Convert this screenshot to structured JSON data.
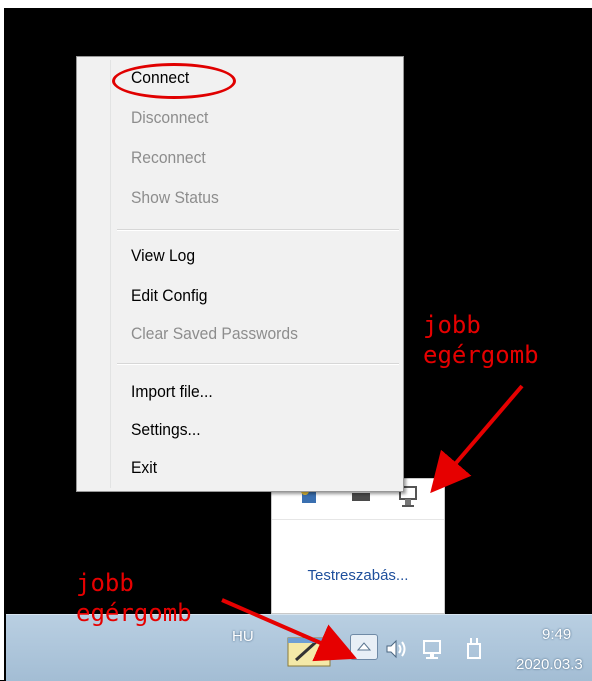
{
  "menu": {
    "items": [
      {
        "label": "Connect",
        "enabled": true
      },
      {
        "label": "Disconnect",
        "enabled": false
      },
      {
        "label": "Reconnect",
        "enabled": false
      },
      {
        "label": "Show Status",
        "enabled": false
      },
      {
        "label": "View Log",
        "enabled": true
      },
      {
        "label": "Edit Config",
        "enabled": true
      },
      {
        "label": "Clear Saved Passwords",
        "enabled": false
      },
      {
        "label": "Import file...",
        "enabled": true
      },
      {
        "label": "Settings...",
        "enabled": true
      },
      {
        "label": "Exit",
        "enabled": true
      }
    ]
  },
  "tray_popup": {
    "customize_label": "Testreszabás..."
  },
  "taskbar": {
    "language": "HU",
    "time": "9:49",
    "date": "2020.03.3"
  },
  "annotations": {
    "menu_hint_line1": "jobb",
    "menu_hint_line2": "egérgomb",
    "taskbar_hint_line1": "jobb",
    "taskbar_hint_line2": "egérgomb"
  },
  "colors": {
    "annotation": "#e60000",
    "taskbar": "#a3bdd4",
    "link": "#1e4f9c"
  }
}
